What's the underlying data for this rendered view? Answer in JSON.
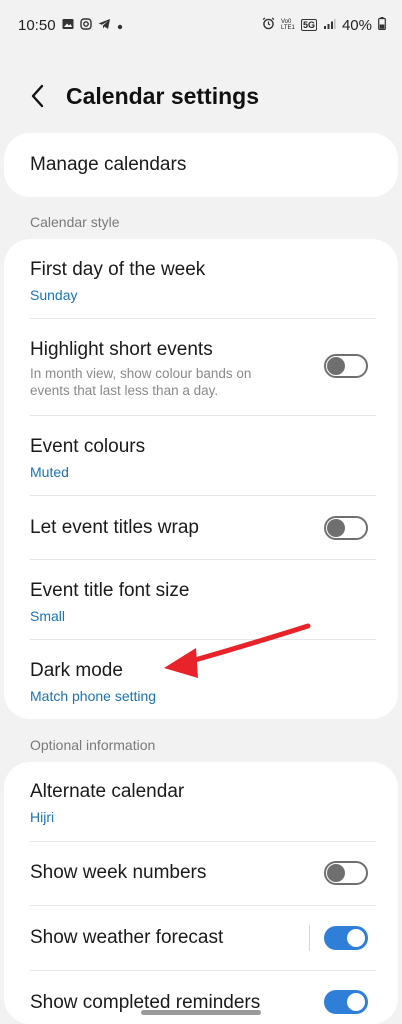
{
  "status_bar": {
    "time": "10:50",
    "notification_icons": [
      "gallery-icon",
      "instagram-icon",
      "telegram-icon",
      "dot-icon"
    ],
    "right_icons": [
      "alarm-icon",
      "volte-icon",
      "5g-icon",
      "signal-icon"
    ],
    "volte_text": "Vo0 LTE1",
    "network_text": "5G",
    "battery": "40%"
  },
  "header": {
    "title": "Calendar settings",
    "back_icon": "back-chevron-icon"
  },
  "manage": {
    "label": "Manage calendars"
  },
  "calendar_style": {
    "section_label": "Calendar style",
    "first_day": {
      "title": "First day of the week",
      "value": "Sunday"
    },
    "highlight_short": {
      "title": "Highlight short events",
      "description": "In month view, show colour bands on events that last less than a day.",
      "enabled": false
    },
    "event_colours": {
      "title": "Event colours",
      "value": "Muted"
    },
    "wrap_titles": {
      "title": "Let event titles wrap",
      "enabled": false
    },
    "font_size": {
      "title": "Event title font size",
      "value": "Small"
    },
    "dark_mode": {
      "title": "Dark mode",
      "value": "Match phone setting"
    }
  },
  "optional_information": {
    "section_label": "Optional information",
    "alternate_calendar": {
      "title": "Alternate calendar",
      "value": "Hijri"
    },
    "week_numbers": {
      "title": "Show week numbers",
      "enabled": false
    },
    "weather_forecast": {
      "title": "Show weather forecast",
      "enabled": true
    },
    "completed_reminders": {
      "title": "Show completed reminders",
      "enabled": true
    }
  },
  "colors": {
    "accent": "#2f7fd8",
    "link": "#1a73b5",
    "annotation_arrow": "#e8232a",
    "background": "#f2f2f2"
  }
}
